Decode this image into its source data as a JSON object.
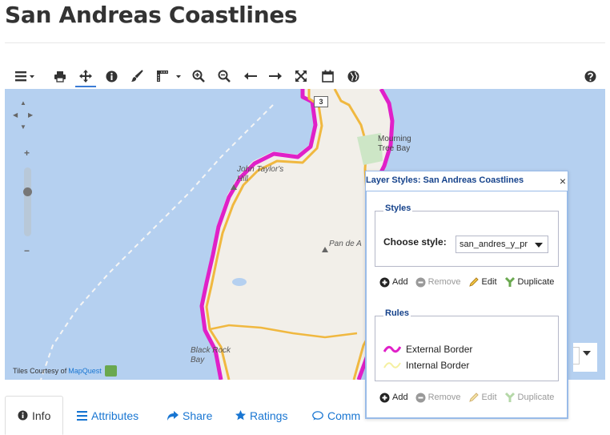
{
  "page": {
    "title": "San Andreas Coastlines"
  },
  "toolbar": {
    "tools": [
      {
        "name": "menu",
        "icon": "menu-icon"
      },
      {
        "name": "print",
        "icon": "print-icon"
      },
      {
        "name": "pan",
        "icon": "pan-icon"
      },
      {
        "name": "identify",
        "icon": "info-icon"
      },
      {
        "name": "style",
        "icon": "paintbrush-icon"
      },
      {
        "name": "measure",
        "icon": "ruler-icon"
      },
      {
        "name": "zoom-in",
        "icon": "zoom-in-icon"
      },
      {
        "name": "zoom-out",
        "icon": "zoom-out-icon"
      },
      {
        "name": "previous-extent",
        "icon": "arrow-left-icon"
      },
      {
        "name": "next-extent",
        "icon": "arrow-right-icon"
      },
      {
        "name": "full-extent",
        "icon": "fullscreen-icon"
      },
      {
        "name": "calendar",
        "icon": "calendar-icon"
      },
      {
        "name": "globe",
        "icon": "globe-icon"
      },
      {
        "name": "help",
        "icon": "help-icon"
      }
    ]
  },
  "map": {
    "place_labels": {
      "mourning_tree_bay": "Mourning\nTree Bay",
      "john_taylors_hill": "John Taylor's\nHill",
      "pan_de": "Pan de A",
      "black_rock_bay": "Black Rock\nBay"
    },
    "highway_shield": "3",
    "tiles_credit_prefix": "Tiles Courtesy of",
    "tiles_credit_link": "MapQuest",
    "colors": {
      "water": "#b5d0f0",
      "land": "#f2efe9",
      "external_border": "#e020c8",
      "internal_border": "#f0c040"
    }
  },
  "layer_styles": {
    "title": "Layer Styles: San Andreas Coastlines",
    "close_glyph": "×",
    "styles_legend": "Styles",
    "choose_style_label": "Choose style:",
    "choose_style_value": "san_andres_y_pr",
    "styles_actions": [
      {
        "label": "Add",
        "enabled": true,
        "icon": "add-circle-icon"
      },
      {
        "label": "Remove",
        "enabled": false,
        "icon": "remove-circle-icon"
      },
      {
        "label": "Edit",
        "enabled": true,
        "icon": "pencil-icon"
      },
      {
        "label": "Duplicate",
        "enabled": true,
        "icon": "duplicate-icon"
      }
    ],
    "rules_legend": "Rules",
    "rules": [
      {
        "label": "External Border",
        "color": "#e020c8"
      },
      {
        "label": "Internal Border",
        "color": "#f5f0a0"
      }
    ],
    "rules_actions": [
      {
        "label": "Add",
        "enabled": true,
        "icon": "add-circle-icon"
      },
      {
        "label": "Remove",
        "enabled": false,
        "icon": "remove-circle-icon"
      },
      {
        "label": "Edit",
        "enabled": false,
        "icon": "pencil-icon"
      },
      {
        "label": "Duplicate",
        "enabled": false,
        "icon": "duplicate-icon"
      }
    ]
  },
  "tabs": [
    {
      "label": "Info",
      "icon": "info-icon",
      "active": true
    },
    {
      "label": "Attributes",
      "icon": "list-icon",
      "active": false
    },
    {
      "label": "Share",
      "icon": "share-icon",
      "active": false
    },
    {
      "label": "Ratings",
      "icon": "star-icon",
      "active": false
    },
    {
      "label": "Comm",
      "icon": "comment-icon",
      "active": false
    }
  ]
}
